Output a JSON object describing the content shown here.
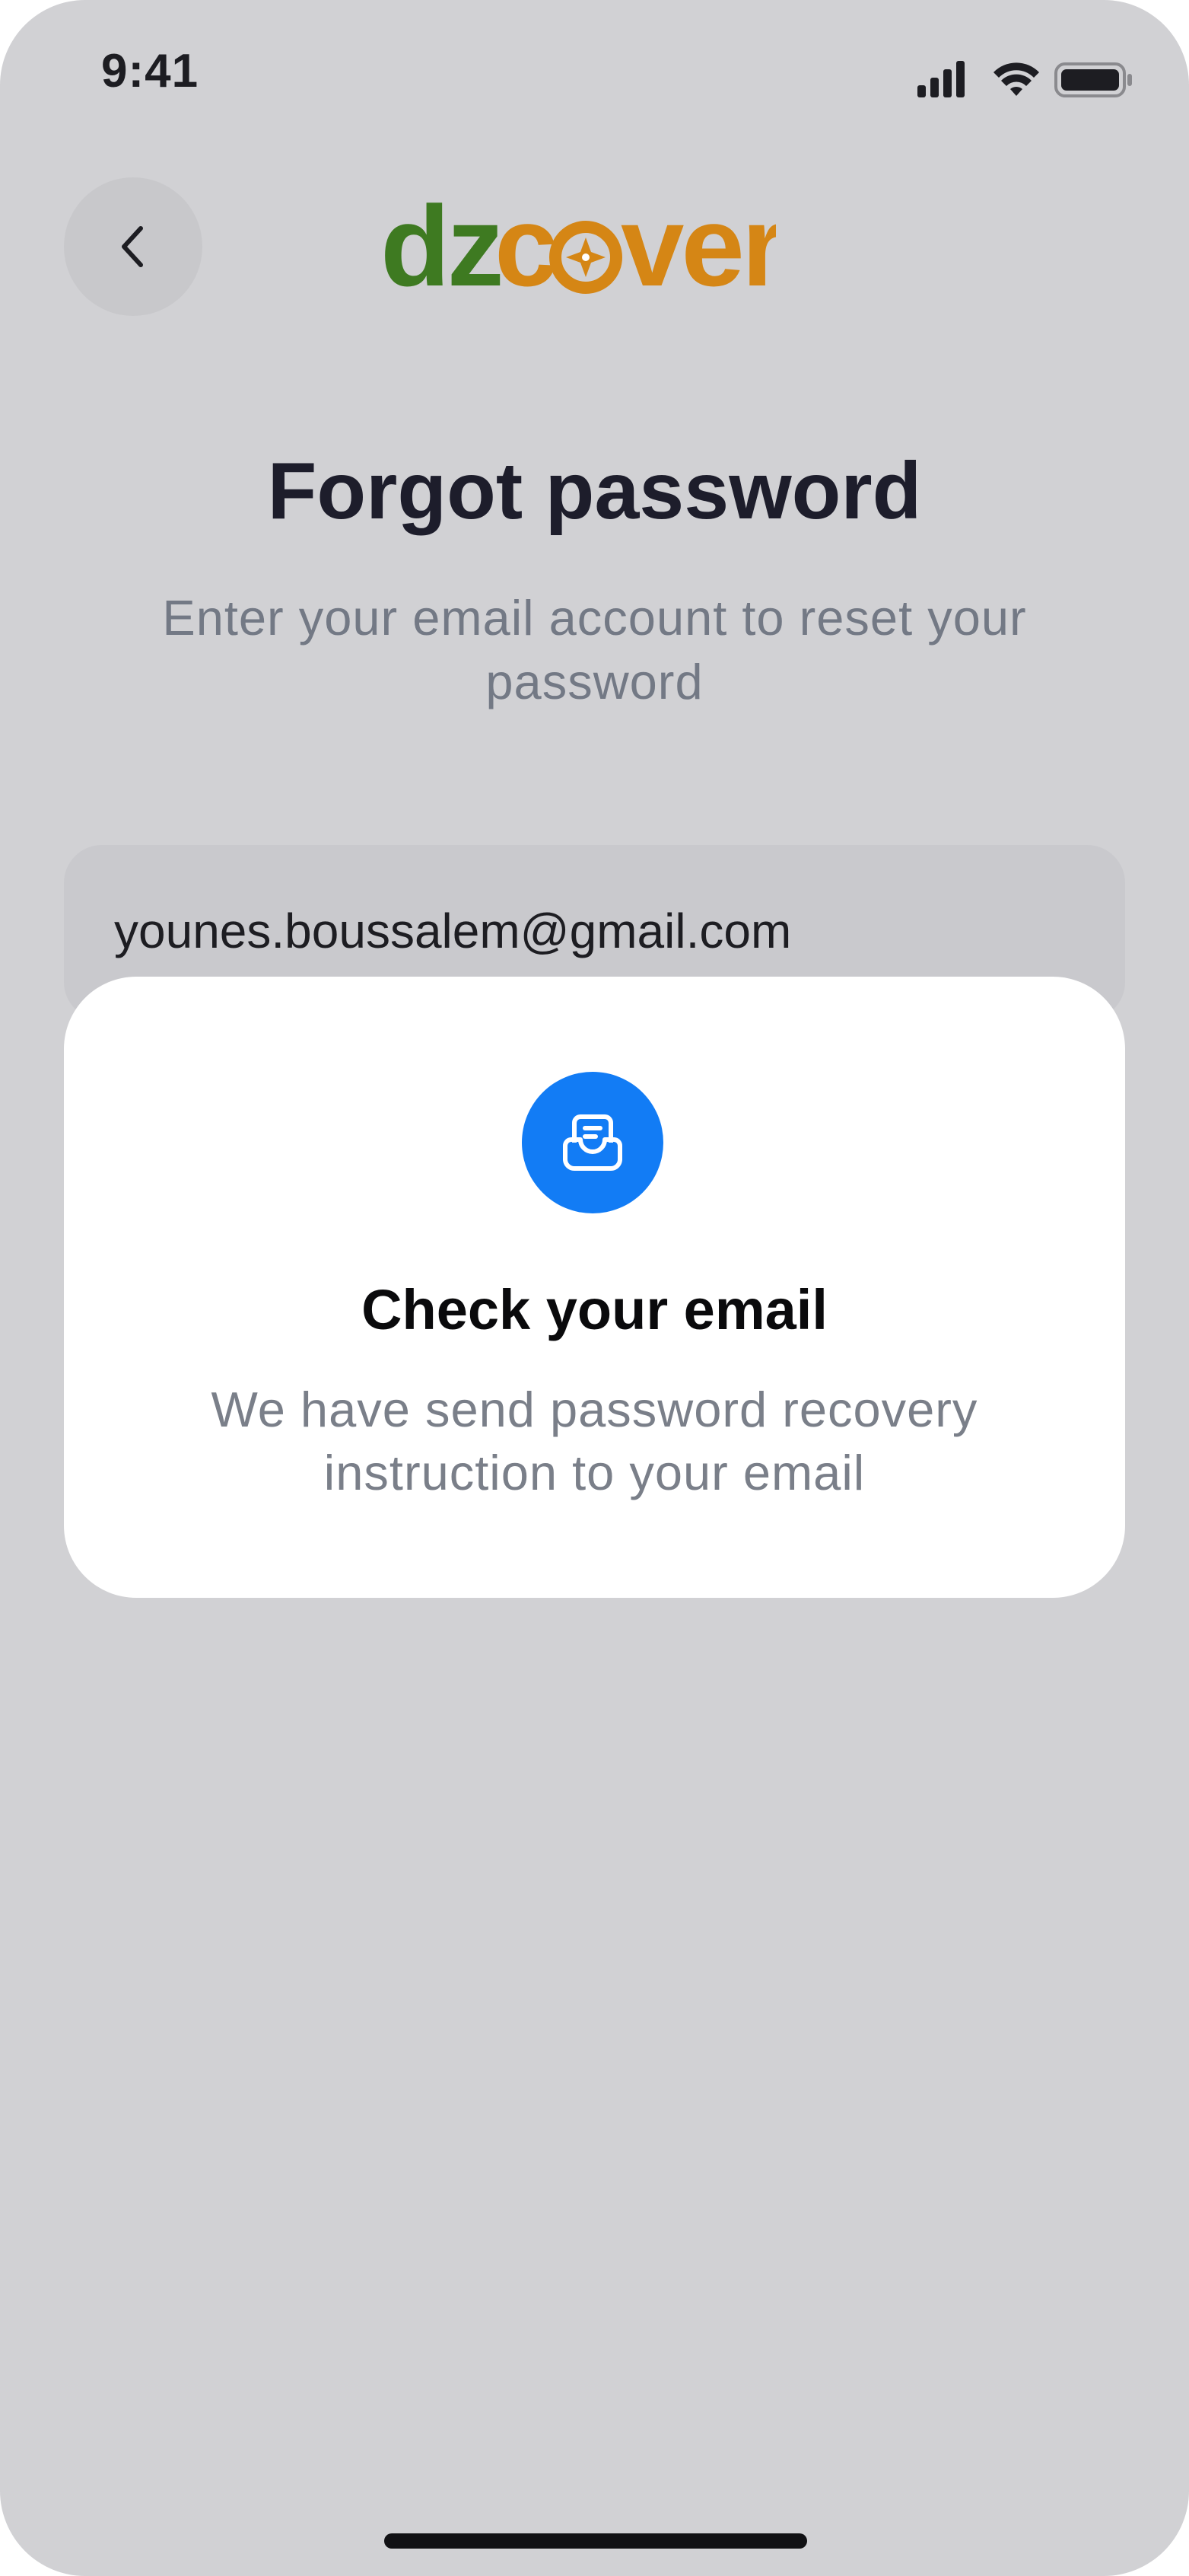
{
  "status_bar": {
    "time": "9:41",
    "icons": [
      "signal-icon",
      "wifi-icon",
      "battery-icon"
    ]
  },
  "header": {
    "back_icon": "chevron-left-icon",
    "logo": {
      "text_part1": "dz",
      "text_part2": "c",
      "text_part3": "ver",
      "colors": {
        "green": "#3e7a21",
        "orange": "#d58615"
      }
    }
  },
  "main": {
    "title": "Forgot password",
    "subtitle": "Enter your email account to reset your password",
    "email_value": "younes.boussalem@gmail.com"
  },
  "modal": {
    "icon": "mail-inbox-icon",
    "title": "Check your email",
    "body": "We have send password recovery instruction to your email",
    "accent_color": "#127cf5"
  }
}
